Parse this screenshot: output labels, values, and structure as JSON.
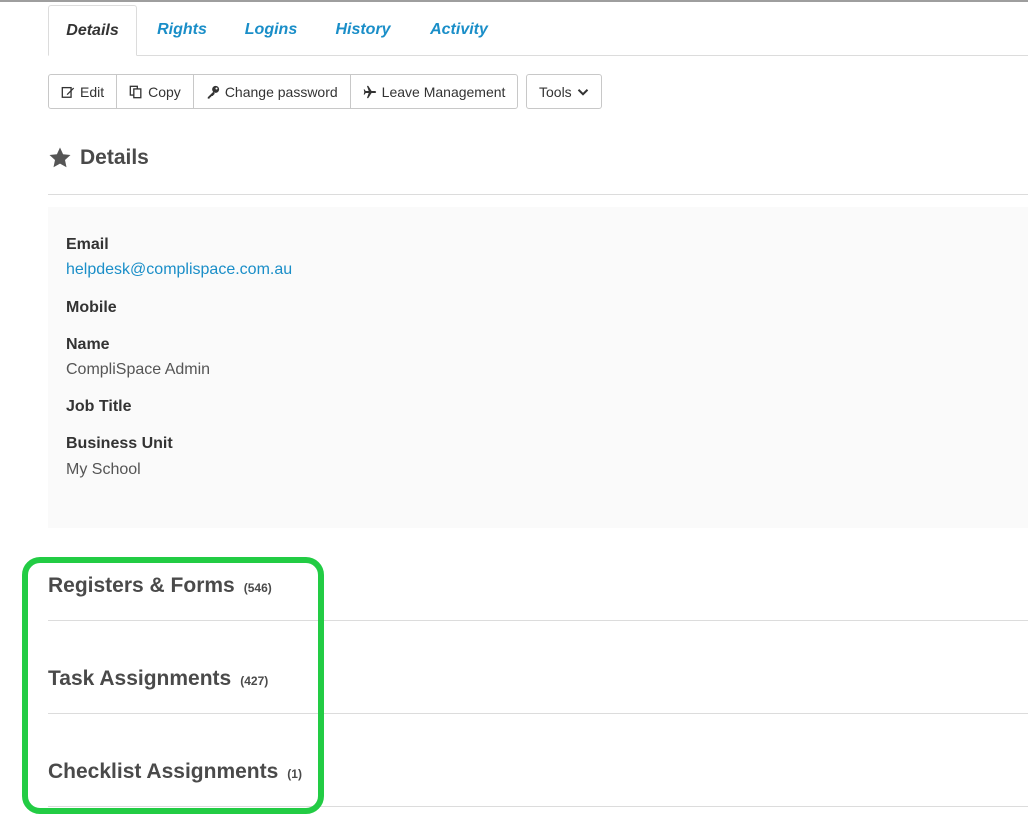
{
  "tabs": [
    {
      "label": "Details",
      "active": true
    },
    {
      "label": "Rights"
    },
    {
      "label": "Logins"
    },
    {
      "label": "History"
    },
    {
      "label": "Activity"
    }
  ],
  "toolbar": {
    "edit_label": "Edit",
    "copy_label": "Copy",
    "change_password_label": "Change password",
    "leave_management_label": "Leave Management",
    "tools_label": "Tools"
  },
  "details": {
    "title": "Details",
    "fields": [
      {
        "label": "Email",
        "value": "helpdesk@complispace.com.au"
      },
      {
        "label": "Mobile",
        "value": ""
      },
      {
        "label": "Name",
        "value": "CompliSpace Admin"
      },
      {
        "label": "Job Title",
        "value": ""
      },
      {
        "label": "Business Unit",
        "value": "My School"
      }
    ]
  },
  "sections": [
    {
      "title": "Registers & Forms",
      "count": "(546)"
    },
    {
      "title": "Task Assignments",
      "count": "(427)"
    },
    {
      "title": "Checklist Assignments",
      "count": "(1)"
    }
  ],
  "colors": {
    "link": "#1a8ec8",
    "highlight": "#22cc44"
  },
  "icons": {
    "edit": "edit-icon",
    "copy": "copy-icon",
    "key": "key-icon",
    "plane": "plane-icon",
    "chevron": "chevron-down-icon",
    "star": "star-icon"
  }
}
